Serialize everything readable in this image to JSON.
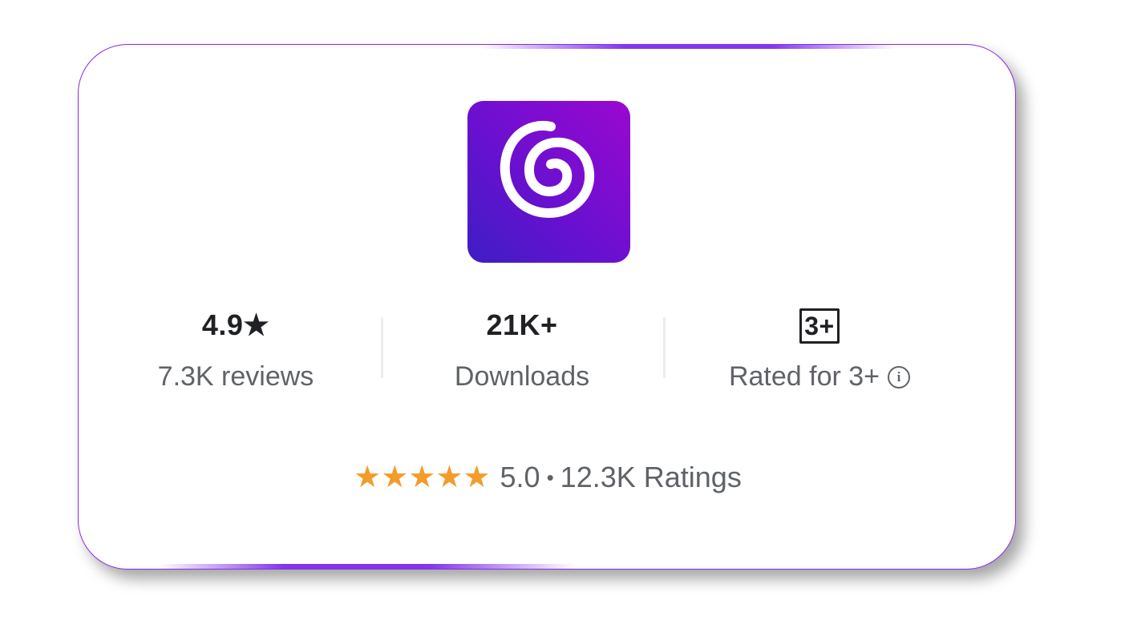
{
  "card": {
    "app_icon": {
      "name": "spiral-app-icon",
      "gradient": [
        "#3d1ec4",
        "#9a08cf"
      ]
    },
    "stats": [
      {
        "value": "4.9",
        "value_suffix_icon": "star-icon",
        "label": "7.3K reviews"
      },
      {
        "value": "21K+",
        "label": "Downloads"
      },
      {
        "badge": "3+",
        "label": "Rated for 3+",
        "label_icon": "info-icon"
      }
    ],
    "ratings": {
      "stars": "★★★★★",
      "score": "5.0",
      "separator": "•",
      "count": "12.3K Ratings"
    }
  },
  "colors": {
    "accent": "#8a2be2",
    "star": "#f39c2a",
    "text_primary": "#202124",
    "text_secondary": "#5f6368"
  }
}
